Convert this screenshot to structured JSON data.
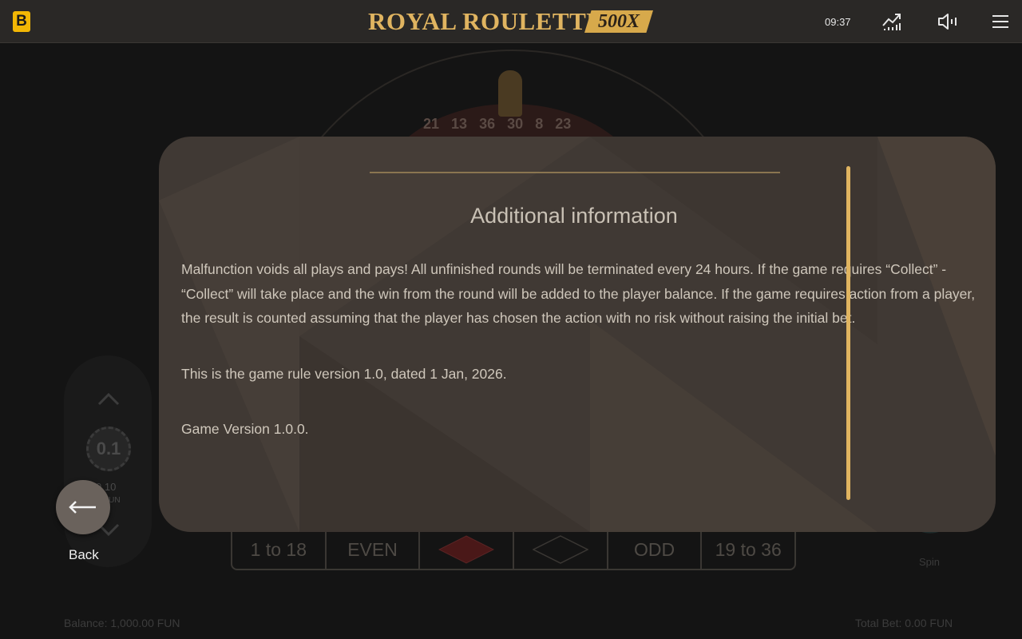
{
  "header": {
    "brand_letter": "B",
    "title": "ROYAL ROULETTE",
    "badge": "500X",
    "clock": "09:37",
    "icons": [
      "stats-icon",
      "sound-icon",
      "menu-icon"
    ],
    "accent_color": "#e0b460"
  },
  "background_game": {
    "wheel_numbers": [
      "21",
      "13",
      "36",
      "30",
      "8",
      "23"
    ],
    "chip_value_label": "0.1",
    "bet_value": "0.10",
    "bet_unit": "FUN",
    "bet_row": [
      "1 to 18",
      "EVEN",
      "red-diamond",
      "black-diamond",
      "ODD",
      "19 to 36"
    ],
    "spin_label": "Spin",
    "balance": "Balance: 1,000.00 FUN",
    "total_bet": "Total Bet: 0.00 FUN"
  },
  "modal": {
    "title": "Additional information",
    "paragraphs": [
      "Malfunction voids all plays and pays! All unfinished rounds will be terminated every 24 hours. If the game requires “Collect” - “Collect” will take place and the win from the round will be added to the player balance. If the game requires action from a player, the result is counted assuming that the player has chosen the action with no risk without raising the initial bet.",
      "This is the game rule version 1.0, dated 1 Jan, 2026.",
      "Game Version 1.0.0."
    ]
  },
  "back": {
    "label": "Back"
  }
}
